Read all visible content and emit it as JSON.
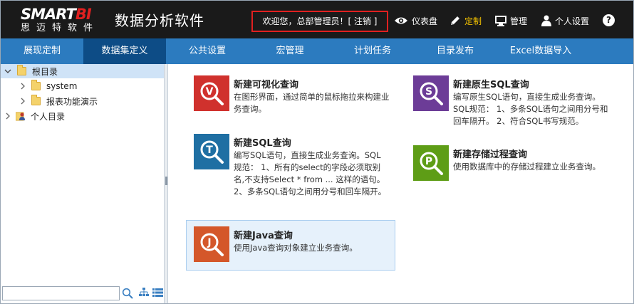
{
  "header": {
    "logo_main": "SMARTBI",
    "logo_sub": "思迈特软件",
    "title": "数据分析软件",
    "welcome": "欢迎您，总部管理员！[ 注销 ]",
    "buttons": [
      {
        "label": "仪表盘",
        "icon": "eye-icon"
      },
      {
        "label": "定制",
        "icon": "pencil-icon",
        "active": true
      },
      {
        "label": "管理",
        "icon": "monitor-icon"
      },
      {
        "label": "个人设置",
        "icon": "user-icon"
      }
    ],
    "help": "?"
  },
  "nav": {
    "items": [
      "展现定制",
      "数据集定义",
      "公共设置",
      "宏管理",
      "计划任务",
      "目录发布",
      "Excel数据导入"
    ],
    "selected": "数据集定义"
  },
  "sidebar": {
    "tree": [
      {
        "label": "根目录",
        "expanded": true,
        "selected": true
      },
      {
        "label": "system"
      },
      {
        "label": "报表功能演示"
      },
      {
        "label": "个人目录"
      }
    ],
    "search_value": ""
  },
  "cards": [
    {
      "title": "新建可视化查询",
      "desc": "在图形界面，通过简单的鼠标拖拉来构建业务查询。",
      "icon_letter": "V",
      "color": "#d0312d"
    },
    {
      "title": "新建原生SQL查询",
      "desc": "编写原生SQL语句，直接生成业务查询。SQL规范： 1、多条SQL语句之间用分号和回车隔开。 2、符合SQL书写规范。",
      "icon_letter": "S",
      "color": "#6c3c97"
    },
    {
      "title": "新建SQL查询",
      "desc": "编写SQL语句，直接生成业务查询。SQL规范： 1、所有的select的字段必须取别名,不支持Select * from ... 这样的语句。 2、多条SQL语句之间用分号和回车隔开。",
      "icon_letter": "T",
      "color": "#1f6fa3"
    },
    {
      "title": "新建存储过程查询",
      "desc": "使用数据库中的存储过程建立业务查询。",
      "icon_letter": "P",
      "color": "#5e9d16"
    },
    {
      "title": "新建Java查询",
      "desc": "使用Java查询对象建立业务查询。",
      "icon_letter": "J",
      "color": "#d4572a"
    }
  ]
}
